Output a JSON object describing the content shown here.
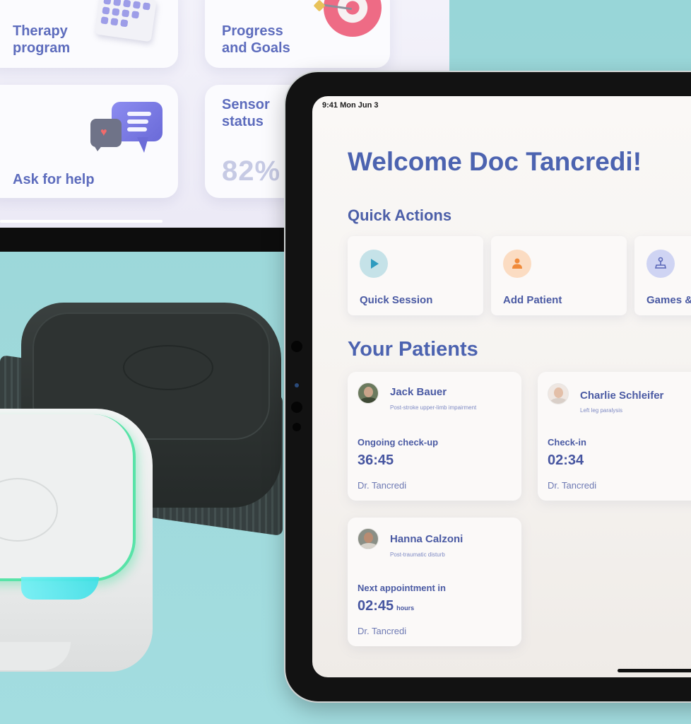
{
  "background_app": {
    "cards": [
      {
        "label": "Therapy\nprogram",
        "icon": "calendar-icon"
      },
      {
        "label": "Progress\nand Goals",
        "icon": "target-icon"
      },
      {
        "label": "Ask for help",
        "icon": "chat-bubbles-icon"
      },
      {
        "label": "Sensor\nstatus",
        "value": "82%"
      }
    ]
  },
  "status_bar": {
    "time": "9:41 Mon Jun 3"
  },
  "main": {
    "welcome": "Welcome Doc Tancredi!",
    "quick_actions_title": "Quick Actions",
    "quick_actions": [
      {
        "label": "Quick Session",
        "icon": "play-icon",
        "color": "#2e9bbf",
        "bg": "#c5e2e8"
      },
      {
        "label": "Add Patient",
        "icon": "person-icon",
        "color": "#f08a3a",
        "bg": "#fbdcc2"
      },
      {
        "label": "Games &",
        "icon": "joystick-icon",
        "color": "#5a67b8",
        "bg": "#cfd4f3"
      }
    ],
    "patients_title": "Your Patients",
    "patients": [
      {
        "name": "Jack Bauer",
        "condition": "Post-stroke upper-limb impairment",
        "status": "Ongoing check-up",
        "time": "36:45",
        "unit": "",
        "doctor": "Dr. Tancredi"
      },
      {
        "name": "Charlie Schleifer",
        "condition": "Left leg paralysis",
        "status": "Check-in",
        "time": "02:34",
        "unit": "",
        "doctor": "Dr. Tancredi"
      },
      {
        "name": "Hanna Calzoni",
        "condition": "Post-traumatic disturb",
        "status": "Next appointment in",
        "time": "02:45",
        "unit": "hours",
        "doctor": "Dr. Tancredi"
      }
    ]
  },
  "colors": {
    "primary_text": "#4c63b0",
    "background_teal": "#9fd9db",
    "sensor_glow": "#58e3a8"
  }
}
